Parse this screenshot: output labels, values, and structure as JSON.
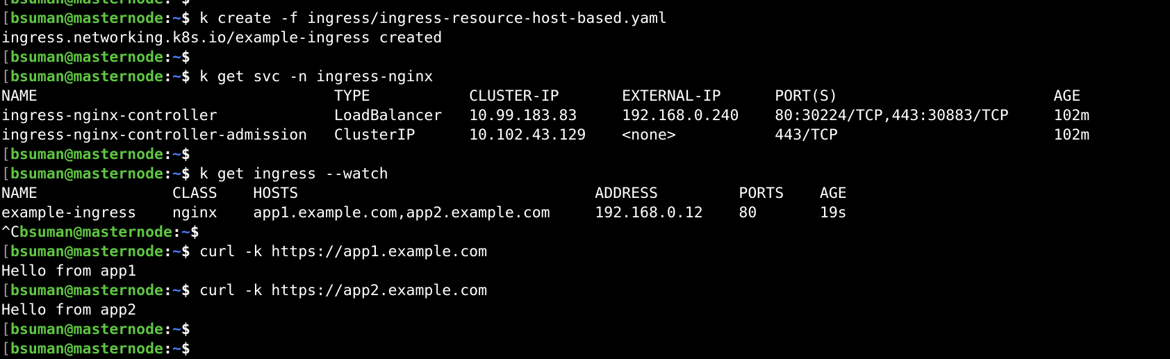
{
  "prompt": {
    "user_host": "bsuman@masternode",
    "colon": ":",
    "path": "~",
    "dollar": "$",
    "bracket": "["
  },
  "lines": [
    {
      "type": "prompt",
      "command": ""
    },
    {
      "type": "prompt",
      "command": " k create -f ingress/ingress-resource-host-based.yaml"
    },
    {
      "type": "output",
      "text": "ingress.networking.k8s.io/example-ingress created"
    },
    {
      "type": "prompt",
      "command": ""
    },
    {
      "type": "prompt",
      "command": " k get svc -n ingress-nginx"
    },
    {
      "type": "output",
      "text": "NAME                                 TYPE           CLUSTER-IP       EXTERNAL-IP      PORT(S)                        AGE"
    },
    {
      "type": "output",
      "text": "ingress-nginx-controller             LoadBalancer   10.99.183.83     192.168.0.240    80:30224/TCP,443:30883/TCP     102m"
    },
    {
      "type": "output",
      "text": "ingress-nginx-controller-admission   ClusterIP      10.102.43.129    <none>           443/TCP                        102m"
    },
    {
      "type": "prompt",
      "command": ""
    },
    {
      "type": "prompt",
      "command": " k get ingress --watch"
    },
    {
      "type": "output",
      "text": "NAME               CLASS    HOSTS                                 ADDRESS         PORTS    AGE"
    },
    {
      "type": "output",
      "text": "example-ingress    nginx    app1.example.com,app2.example.com     192.168.0.12    80       19s"
    },
    {
      "type": "ctrlc_prompt",
      "prefix": "^C",
      "command": ""
    },
    {
      "type": "prompt",
      "command": " curl -k https://app1.example.com"
    },
    {
      "type": "output",
      "text": "Hello from app1"
    },
    {
      "type": "prompt",
      "command": " curl -k https://app2.example.com"
    },
    {
      "type": "output",
      "text": "Hello from app2"
    },
    {
      "type": "prompt",
      "command": ""
    },
    {
      "type": "prompt",
      "command": ""
    }
  ]
}
